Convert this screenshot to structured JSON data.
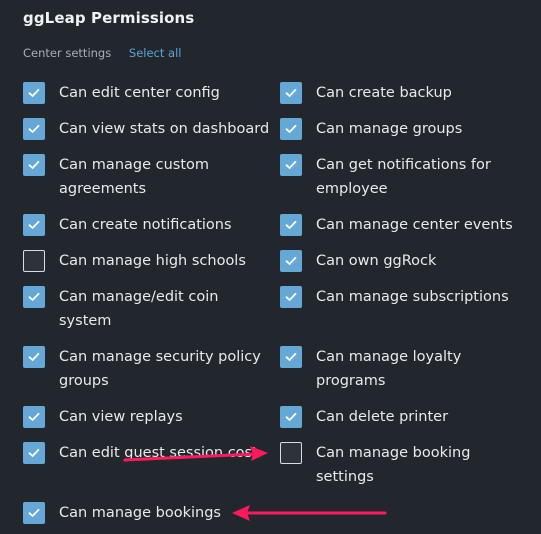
{
  "header": {
    "title": "ggLeap Permissions"
  },
  "section": {
    "label": "Center settings",
    "select_all_label": "Select all"
  },
  "colors": {
    "checked": "#65a8d8",
    "accent_link": "#5ea4d6",
    "arrow": "#ff1a5c",
    "background": "#22272e"
  },
  "permissions": [
    {
      "label": "Can edit center config",
      "checked": true
    },
    {
      "label": "Can create backup",
      "checked": true
    },
    {
      "label": "Can view stats on dashboard",
      "checked": true
    },
    {
      "label": "Can manage groups",
      "checked": true
    },
    {
      "label": "Can manage custom agreements",
      "checked": true
    },
    {
      "label": "Can get notifications for employee",
      "checked": true
    },
    {
      "label": "Can create notifications",
      "checked": true
    },
    {
      "label": "Can manage center events",
      "checked": true
    },
    {
      "label": "Can manage high schools",
      "checked": false
    },
    {
      "label": "Can own ggRock",
      "checked": true
    },
    {
      "label": "Can manage/edit coin system",
      "checked": true
    },
    {
      "label": "Can manage subscriptions",
      "checked": true
    },
    {
      "label": "Can manage security policy groups",
      "checked": true
    },
    {
      "label": "Can manage loyalty programs",
      "checked": true
    },
    {
      "label": "Can view replays",
      "checked": true
    },
    {
      "label": "Can delete printer",
      "checked": true
    },
    {
      "label": "Can edit guest session cost",
      "checked": true
    },
    {
      "label": "Can manage booking settings",
      "checked": false
    },
    {
      "label": "Can manage bookings",
      "checked": true
    }
  ],
  "annotations": [
    {
      "type": "arrow",
      "points_to": "Can manage booking settings"
    },
    {
      "type": "arrow",
      "points_to": "Can manage bookings"
    }
  ]
}
